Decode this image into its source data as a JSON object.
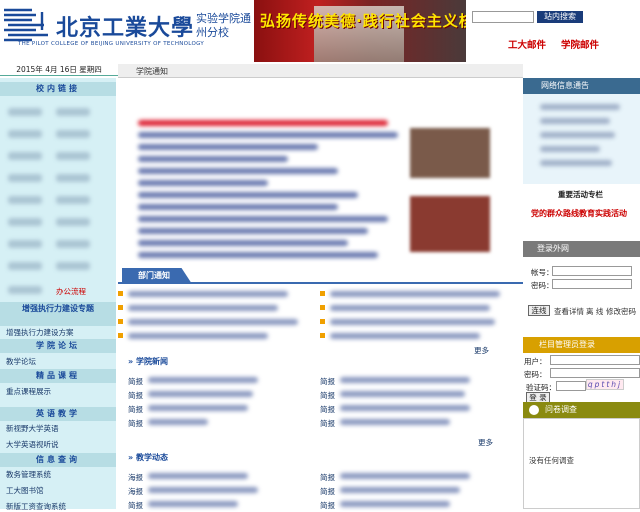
{
  "header": {
    "logo_cn": "北京工業大學",
    "logo_sub": "实验学院通州分校",
    "logo_en": "THE PILOT COLLEGE OF BEIJING UNIVERSITY OF TECHNOLOGY",
    "banner_slogan": "弘扬传统美德·践行社会主义核心价值观",
    "search_button": "站内搜索",
    "mail_links": [
      "工大邮件",
      "学院邮件"
    ]
  },
  "date": "2015年 4月 16日 星期四",
  "center": {
    "notice_title": "学院通知",
    "dept_tab": "部门通知",
    "college_news": "学院新闻",
    "teaching_news": "教学动态",
    "more": "更多",
    "jianbao": "简报",
    "haibao": "海报"
  },
  "left": {
    "internal_links": "校内链接",
    "office_link": "办公流程",
    "exec_title": "增强执行力建设专题",
    "exec_link": "增强执行力建设方案",
    "forum_title": "学院论坛",
    "forum_link": "教学论坛",
    "course_title": "精品课程",
    "course_link": "重点课程展示",
    "english_title": "英语教学",
    "english_links": [
      "新视野大学英语",
      "大学英语视听说"
    ],
    "info_title": "信息查询",
    "info_links": [
      "教务管理系统",
      "工大图书馆",
      "新版工资查询系统"
    ]
  },
  "right": {
    "network_notice": "网络信息通告",
    "key_activity_title": "重要活动专栏",
    "key_activity_link": "党的群众路线教育实践活动",
    "login_title": "登录外网",
    "account_label": "帐号：",
    "password_label": "密码：",
    "connect_button": "连线",
    "detail_text": "查看详情",
    "disconnect_text": "离 线",
    "change_pwd": "修改密码",
    "admin_title": "栏目管理员登录",
    "user_label": "用户：",
    "pwd_label": "密码：",
    "captcha_label": "验证码：",
    "captcha_value": "qptthj",
    "login_button": "登 录",
    "survey_title": "问卷调查",
    "no_survey": "没有任何调查"
  }
}
